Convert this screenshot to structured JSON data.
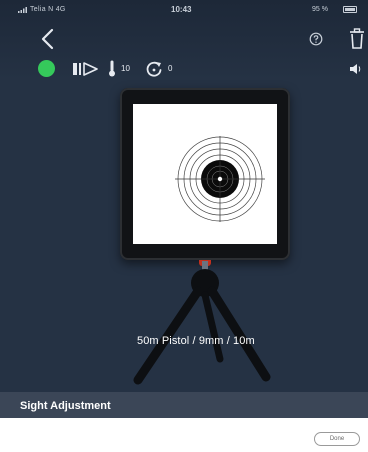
{
  "status_bar": {
    "carrier": "Telia N  4G",
    "time": "10:43",
    "battery": "95 %"
  },
  "nav": {
    "back_icon": "chevron-left-icon",
    "help_icon": "help-circle-icon",
    "trash_icon": "trash-icon"
  },
  "toolbar": {
    "connected_color": "#35c95b",
    "temperature": "10",
    "resets": "0"
  },
  "target": {
    "profile": "50m Pistol / 9mm / 10m"
  },
  "section": {
    "title": "Sight Adjustment"
  },
  "footer": {
    "done_label": "Done"
  },
  "colors": {
    "background": "#253244",
    "section_bar": "#3b4657",
    "foot_accent": "#c2301e"
  }
}
